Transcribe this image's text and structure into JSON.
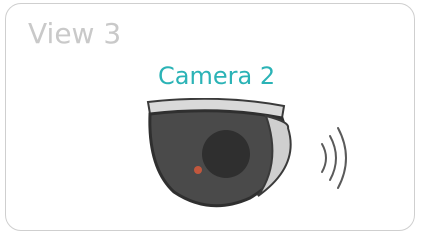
{
  "view": {
    "title": "View 3"
  },
  "camera": {
    "label": "Camera 2",
    "icon": "dome-camera-icon",
    "status_icon": "wireless-signal-icon"
  },
  "colors": {
    "title_gray": "#c9c9c9",
    "accent_teal": "#2bb3b6",
    "camera_dark": "#4a4a4a",
    "indicator_red": "#e05a3a"
  }
}
